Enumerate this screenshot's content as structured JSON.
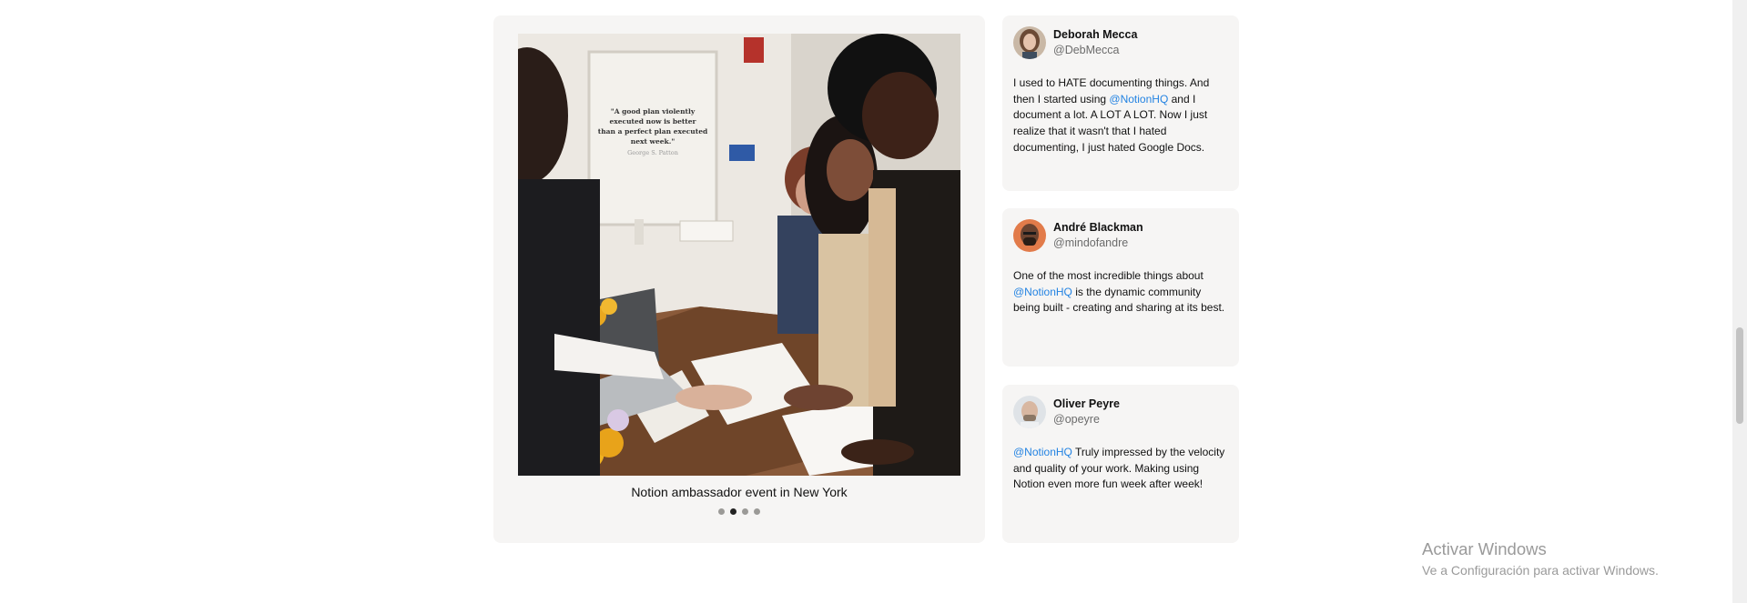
{
  "carousel": {
    "caption": "Notion ambassador event in New York",
    "poster_quote": "\"A good plan violently executed now is better than a perfect plan executed next week.\"",
    "poster_author": "George S. Patton",
    "slide_count": 4,
    "active_slide": 2
  },
  "tweets": [
    {
      "name": "Deborah Mecca",
      "handle": "@DebMecca",
      "text_before": "I used to HATE documenting things. And then I started using ",
      "mention": "@NotionHQ",
      "text_after": " and I document a lot. A LOT A LOT. Now I just realize that it wasn't that I hated documenting, I just hated Google Docs."
    },
    {
      "name": "André Blackman",
      "handle": "@mindofandre",
      "text_before": "One of the most incredible things about ",
      "mention": "@NotionHQ",
      "text_after": " is the dynamic community being built - creating and sharing at its best."
    },
    {
      "name": "Oliver Peyre",
      "handle": "@opeyre",
      "text_before": "",
      "mention": "@NotionHQ",
      "text_after": " Truly impressed by the velocity and quality of your work. Making using Notion even more fun week after week!"
    }
  ],
  "watermark": {
    "title": "Activar Windows",
    "subtitle": "Ve a Configuración para activar Windows."
  },
  "colors": {
    "card_bg": "#f6f5f4",
    "mention": "#2383e2",
    "dot_active": "#222222",
    "dot_inactive": "#9b9a97"
  }
}
